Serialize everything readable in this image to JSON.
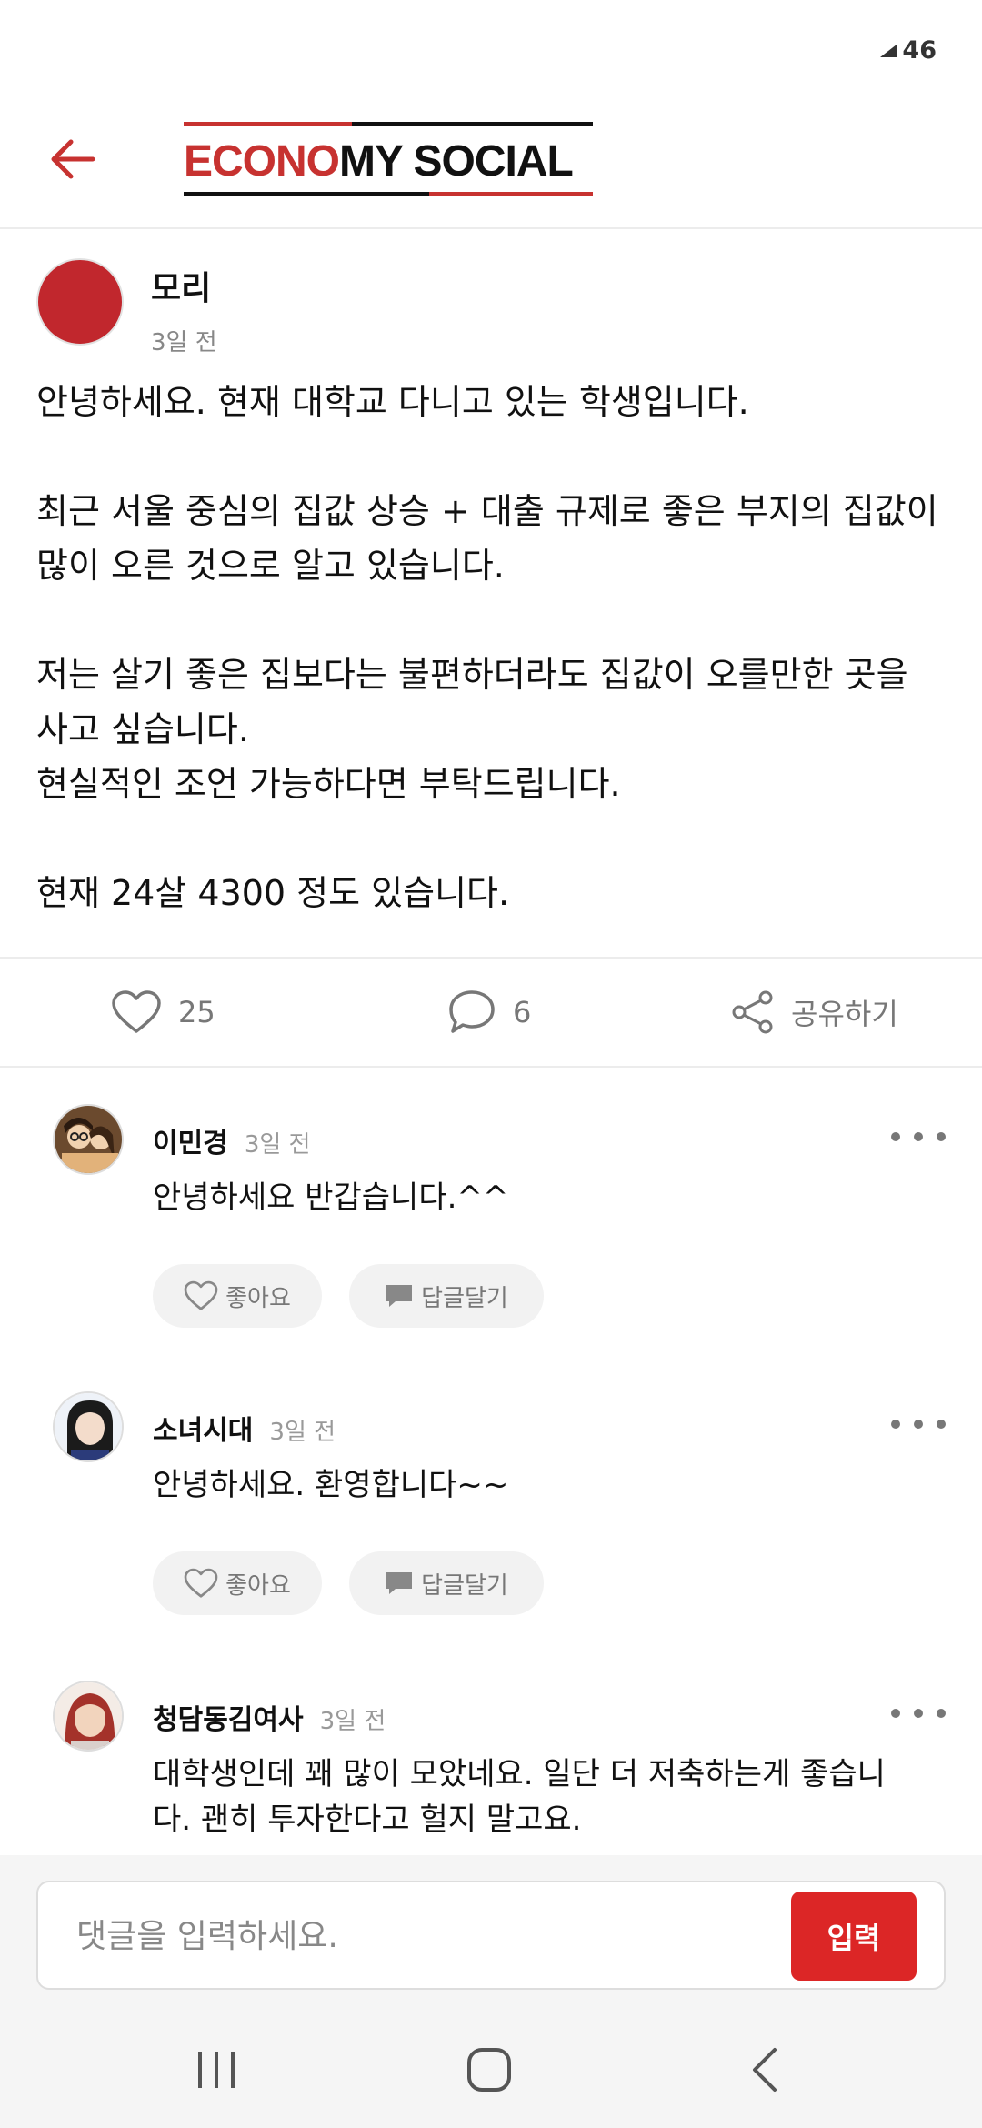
{
  "status_bar": {
    "signal_label": "46"
  },
  "header": {
    "logo_part1": "ECONO",
    "logo_part2": "MY SOCIAL"
  },
  "post": {
    "author": "모리",
    "time": "3일 전",
    "paragraphs": [
      "안녕하세요. 현재 대학교 다니고 있는 학생입니다.",
      "최근 서울 중심의 집값 상승 + 대출 규제로 좋은 부지의 집값이 많이 오른 것으로 알고 있습니다.",
      "저는 살기 좋은 집보다는 불편하더라도 집값이 오를만한 곳을 사고 싶습니다.",
      "현실적인 조언 가능하다면 부탁드립니다.",
      "현재 24살 4300 정도 있습니다."
    ],
    "likes": "25",
    "comments": "6",
    "share_label": "공유하기"
  },
  "comments": [
    {
      "name": "이민경",
      "time": "3일 전",
      "text": "안녕하세요   반갑습니다.^^",
      "like_label": "좋아요",
      "reply_label": "답글달기"
    },
    {
      "name": "소녀시대",
      "time": "3일 전",
      "text": "안녕하세요. 환영합니다~~",
      "like_label": "좋아요",
      "reply_label": "답글달기"
    },
    {
      "name": "청담동김여사",
      "time": "3일 전",
      "text": "대학생인데 꽤 많이 모았네요. 일단 더 저축하는게 좋습니다. 괜히 투자한다고 헐지 말고요."
    }
  ],
  "comment_input": {
    "placeholder": "댓글을 입력하세요.",
    "submit_label": "입력"
  },
  "colors": {
    "brand_red": "#c73230",
    "button_red": "#dc2626",
    "avatar_red": "#c1272d"
  },
  "icons": [
    "back-arrow-icon",
    "heart-icon",
    "comment-bubble-icon",
    "share-icon",
    "more-dots-icon",
    "chat-icon",
    "recent-apps-icon",
    "home-icon",
    "nav-back-icon"
  ]
}
